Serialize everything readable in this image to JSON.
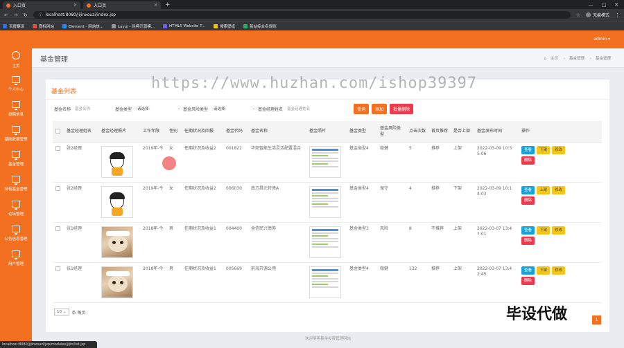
{
  "browser": {
    "tabs": [
      {
        "title": "入口页"
      },
      {
        "title": "入口页"
      }
    ],
    "new_tab": "+",
    "url": "localhost:8080/jijinxouzi/index.jsp",
    "profile": "无痕模式",
    "bookmarks": [
      "百度翻译",
      "图标网站",
      "Element - 网站快...",
      "Layui - 经典开源模...",
      "HTML5 Website T...",
      "搜索壁纸",
      "新站综合名规则"
    ]
  },
  "header": {
    "user": "admin ▾"
  },
  "sidebar": {
    "items": [
      {
        "label": "主页",
        "icon": "home-icon"
      },
      {
        "label": "个人中心",
        "icon": "monitor-icon"
      },
      {
        "label": "投稿信息",
        "icon": "monitor-icon"
      },
      {
        "label": "基础数据管理",
        "icon": "monitor-icon"
      },
      {
        "label": "基金管理",
        "icon": "monitor-icon"
      },
      {
        "label": "持有基金管理",
        "icon": "monitor-icon"
      },
      {
        "label": "论坛管理",
        "icon": "monitor-icon"
      },
      {
        "label": "公告信息管理",
        "icon": "monitor-icon"
      },
      {
        "label": "用户管理",
        "icon": "monitor-icon"
      }
    ]
  },
  "page": {
    "title": "基金管理",
    "breadcrumb": [
      "主页",
      "基金管理",
      "基金管理"
    ]
  },
  "card": {
    "title": "基金列表"
  },
  "search": {
    "name_label": "基金名称",
    "name_placeholder": "基金名称",
    "type_label": "基金类型",
    "type_value": "-请选择-",
    "risk_label": "基金风险类型",
    "risk_value": "-请选择-",
    "manager_label": "基金经理姓名",
    "manager_placeholder": "基金经理姓名",
    "query_btn": "查询",
    "add_btn": "添加",
    "batch_delete_btn": "批量删除"
  },
  "table": {
    "headers": [
      "基金经理姓名",
      "基金经理照片",
      "工作年限",
      "性别",
      "任期状况及回报",
      "基金代码",
      "基金名称",
      "基金照片",
      "基金类型",
      "基金风险类型",
      "点击次数",
      "首页推荐",
      "是否上架",
      "基金发布时间",
      "操作"
    ],
    "rows": [
      {
        "manager": "张2经理",
        "photo": "cartoon",
        "years": "2019年-今",
        "gender": "女",
        "tenure": "任期状况及收益2",
        "code": "001822",
        "name": "华商智能生活灵活配置混合",
        "type": "基金类型4",
        "risk": "稳健",
        "clicks": "5",
        "recommend": "推荐",
        "listed": "上架",
        "time": "2022-03-09 10:35:06",
        "toggle": "下架"
      },
      {
        "manager": "张2经理",
        "photo": "cartoon",
        "years": "2019年-今",
        "gender": "女",
        "tenure": "任期状况及收益2",
        "code": "006030",
        "name": "南方昌元转债A",
        "type": "基金类型4",
        "risk": "保守",
        "clicks": "4",
        "recommend": "推荐",
        "listed": "下架",
        "time": "2022-03-09 10:14:03",
        "toggle": "上架"
      },
      {
        "manager": "张1经理",
        "photo": "cat",
        "years": "2018年-今",
        "gender": "男",
        "tenure": "任期状况及收益1",
        "code": "004400",
        "name": "金信民兴债券",
        "type": "基金类型3",
        "risk": "风险",
        "clicks": "8",
        "recommend": "不推荐",
        "listed": "上架",
        "time": "2022-03-07 13:47:01",
        "toggle": "下架"
      },
      {
        "manager": "张1经理",
        "photo": "cat",
        "years": "2018年-今",
        "gender": "男",
        "tenure": "任期状况及收益1",
        "code": "005669",
        "name": "前海开源公用",
        "type": "基金类型4",
        "risk": "稳健",
        "clicks": "132",
        "recommend": "推荐",
        "listed": "上架",
        "time": "2022-03-07 13:42:45",
        "toggle": "下架"
      }
    ],
    "view_btn": "查看",
    "edit_btn": "修改",
    "delete_btn": "删除"
  },
  "pager": {
    "page_size": "10",
    "page_size_suffix": "条 每页",
    "current_page": "1"
  },
  "watermark": "https://www.huzhan.com/ishop39397",
  "watermark2": "毕设代做",
  "footer": "欢迎使用基金投资管理网站",
  "status_url": "localhost:8080/jijinxouzi/jsp/modules/jijin/list.jsp"
}
